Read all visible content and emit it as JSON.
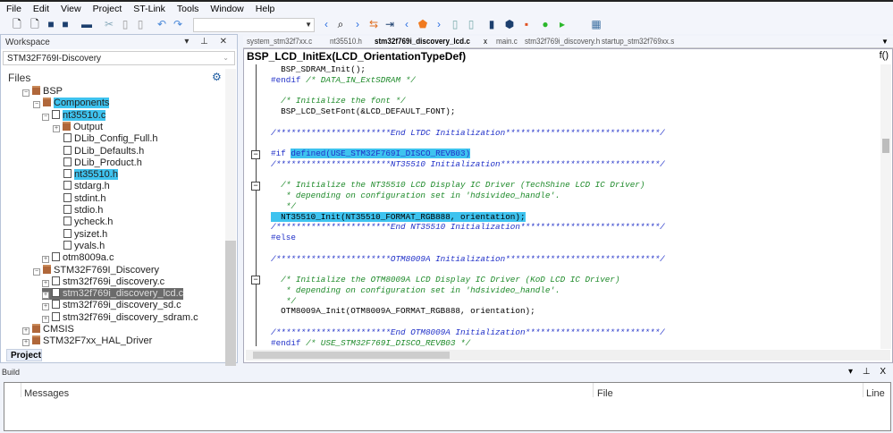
{
  "menu": [
    "File",
    "Edit",
    "View",
    "Project",
    "ST-Link",
    "Tools",
    "Window",
    "Help"
  ],
  "toolbar": {
    "combo_value": ""
  },
  "workspace": {
    "title": "Workspace",
    "controls": "▾ ⊥ ✕",
    "config": "STM32F769I-Discovery",
    "files_label": "Files",
    "tab": "Project"
  },
  "tree": [
    {
      "label": "BSP",
      "type": "folder",
      "indent": 0,
      "exp": "−"
    },
    {
      "label": "Components",
      "type": "folder",
      "indent": 1,
      "exp": "−",
      "highlight": true
    },
    {
      "label": "nt35510.c",
      "type": "file",
      "indent": 2,
      "exp": "−",
      "highlight": true
    },
    {
      "label": "Output",
      "type": "folder",
      "indent": 3,
      "exp": "+"
    },
    {
      "label": "DLib_Config_Full.h",
      "type": "file",
      "indent": 3
    },
    {
      "label": "DLib_Defaults.h",
      "type": "file",
      "indent": 3
    },
    {
      "label": "DLib_Product.h",
      "type": "file",
      "indent": 3
    },
    {
      "label": "nt35510.h",
      "type": "file",
      "indent": 3,
      "highlight": true
    },
    {
      "label": "stdarg.h",
      "type": "file",
      "indent": 3
    },
    {
      "label": "stdint.h",
      "type": "file",
      "indent": 3
    },
    {
      "label": "stdio.h",
      "type": "file",
      "indent": 3
    },
    {
      "label": "ycheck.h",
      "type": "file",
      "indent": 3
    },
    {
      "label": "ysizet.h",
      "type": "file",
      "indent": 3
    },
    {
      "label": "yvals.h",
      "type": "file",
      "indent": 3
    },
    {
      "label": "otm8009a.c",
      "type": "file",
      "indent": 2,
      "exp": "+"
    },
    {
      "label": "STM32F769I_Discovery",
      "type": "folder",
      "indent": 1,
      "exp": "−"
    },
    {
      "label": "stm32f769i_discovery.c",
      "type": "file",
      "indent": 2,
      "exp": "+"
    },
    {
      "label": "stm32f769i_discovery_lcd.c",
      "type": "file",
      "indent": 2,
      "exp": "+",
      "selected": true
    },
    {
      "label": "stm32f769i_discovery_sd.c",
      "type": "file",
      "indent": 2,
      "exp": "+"
    },
    {
      "label": "stm32f769i_discovery_sdram.c",
      "type": "file",
      "indent": 2,
      "exp": "+"
    },
    {
      "label": "CMSIS",
      "type": "folder",
      "indent": 0,
      "exp": "+"
    },
    {
      "label": "STM32F7xx_HAL_Driver",
      "type": "folder",
      "indent": 0,
      "exp": "+"
    }
  ],
  "editor": {
    "tabs": [
      "system_stm32f7xx.c",
      "nt35510.h",
      "stm32f769i_discovery_lcd.c",
      "main.c",
      "stm32f769i_discovery.h",
      "startup_stm32f769xx.s"
    ],
    "active_tab": 2,
    "close": "x",
    "function": "BSP_LCD_InitEx(LCD_OrientationTypeDef)",
    "fx": "f()",
    "lines": [
      [
        [
          "",
          "  BSP_SDRAM_Init();"
        ]
      ],
      [
        [
          "kw",
          "#endif "
        ],
        [
          "cm",
          "/* DATA_IN_ExtSDRAM */"
        ]
      ],
      [
        [
          "",
          ""
        ]
      ],
      [
        [
          "cm",
          "  /* Initialize the font */"
        ]
      ],
      [
        [
          "",
          "  BSP_LCD_SetFont(&LCD_DEFAULT_FONT);"
        ]
      ],
      [
        [
          "",
          ""
        ]
      ],
      [
        [
          "cb",
          "/***********************End LTDC Initialization*******************************/"
        ]
      ],
      [
        [
          "",
          ""
        ]
      ],
      [
        [
          "kw",
          "#if "
        ],
        [
          "hl",
          "defined(USE_STM32F769I_DISCO_REVB03)"
        ]
      ],
      [
        [
          "cb",
          "/***********************NT35510 Initialization********************************/"
        ]
      ],
      [
        [
          "",
          ""
        ]
      ],
      [
        [
          "cm",
          "  /* Initialize the NT35510 LCD Display IC Driver (TechShine LCD IC Driver)"
        ]
      ],
      [
        [
          "cm",
          "   * depending on configuration set in 'hdsivideo_handle'."
        ]
      ],
      [
        [
          "cm",
          "   */"
        ]
      ],
      [
        [
          "hlp",
          "  NT35510_Init(NT35510_FORMAT_RGB888, orientation);"
        ]
      ],
      [
        [
          "cb",
          "/***********************End NT35510 Initialization****************************/"
        ]
      ],
      [
        [
          "kw",
          "#else"
        ]
      ],
      [
        [
          "",
          ""
        ]
      ],
      [
        [
          "cb",
          "/***********************OTM8009A Initialization*******************************/"
        ]
      ],
      [
        [
          "",
          ""
        ]
      ],
      [
        [
          "cm",
          "  /* Initialize the OTM8009A LCD Display IC Driver (KoD LCD IC Driver)"
        ]
      ],
      [
        [
          "cm",
          "   * depending on configuration set in 'hdsivideo_handle'."
        ]
      ],
      [
        [
          "cm",
          "   */"
        ]
      ],
      [
        [
          "",
          "  OTM8009A_Init(OTM8009A_FORMAT_RGB888, orientation);"
        ]
      ],
      [
        [
          "",
          ""
        ]
      ],
      [
        [
          "cb",
          "/***********************End OTM8009A Initialization***************************/"
        ]
      ],
      [
        [
          "kw",
          "#endif "
        ],
        [
          "cm",
          "/* USE_STM32F769I_DISCO_REVB03 */"
        ]
      ]
    ]
  },
  "build": {
    "title": "Build",
    "controls": "▾ ⊥ X",
    "columns": [
      "Messages",
      "File",
      "Line"
    ]
  },
  "colors": {
    "highlight": "#3ec3ef",
    "keyword": "#2030c8",
    "comment": "#1e8a2a"
  }
}
